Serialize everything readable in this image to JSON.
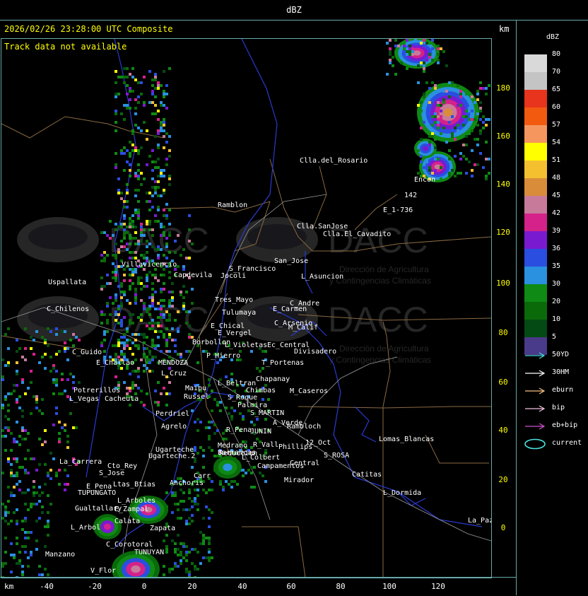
{
  "header": {
    "title": "dBZ"
  },
  "map": {
    "timestamp": "2026/02/26 23:28:00 UTC Composite",
    "track_message": "Track data not available",
    "km_label_top": "km",
    "km_label_bottom": "km",
    "watermark": {
      "name": "DACC",
      "line1": "Dirección de Agricultura",
      "line2": "y Contingencias Climáticas"
    },
    "y_ticks": [
      "180",
      "160",
      "140",
      "120",
      "100",
      "80",
      "60",
      "40",
      "20",
      "0"
    ],
    "x_ticks": [
      "-40",
      "-20",
      "0",
      "20",
      "40",
      "60",
      "80",
      "100",
      "120"
    ],
    "places": [
      "Clla.del_Rosario",
      "Encon",
      "142",
      "E_1-736",
      "Ramblon",
      "Clla.SanJose",
      "Clla.El_Cavadito",
      "San_Jose",
      "S_Francisco",
      "L_Asuncion",
      "Uspallata",
      "Villavicencio",
      "Capdevila",
      "Jocoli",
      "Tres_Mayo",
      "Tulumaya",
      "C_Andre",
      "E_Carmen",
      "C_Chilenos",
      "E_Chical",
      "E_Vergel",
      "C_Arsenio",
      "M_Calif",
      "Borbollon",
      "L_Violetas",
      "Ec_Central",
      "Divisadero",
      "C_Guido",
      "E_Challao",
      "MENDOZA",
      "P_Hierro",
      "T_Portenas",
      "L_Cruz",
      "L_Beltran",
      "Chapanay",
      "Potrerillos",
      "Cacheuta",
      "Maipu",
      "Chimbas",
      "M_Caseros",
      "L_Vegas",
      "Russel",
      "S_Roque",
      "Palmira",
      "Perdriel",
      "S_MARTIN",
      "A_Verde",
      "Agrelo",
      "R_Pena",
      "JUNIN",
      "Rambloch",
      "Lomas_Blancas",
      "Ugarteche",
      "Medrano",
      "R_Vall",
      "Phillips",
      "12_Oct",
      "S_ROSA",
      "La_Carrera",
      "Cto_Rey",
      "Reduccion",
      "L_Colbert",
      "Campamentos",
      "Central",
      "Catitas",
      "S_Jose",
      "E_Pena",
      "Anchoris",
      "Carr",
      "Mirador",
      "TUPUNGATO",
      "L_Dormida",
      "L_Arbol",
      "Gualtallary",
      "E_Zampal",
      "La_Paz",
      "L_Arboles",
      "Calata",
      "Zapata",
      "C_Corotoral",
      "Manzano",
      "TUNUYAN",
      "V_Flor",
      "Ltas_Btias",
      "Barrancas",
      "Ugarteche.2"
    ]
  },
  "legend": {
    "title": "dBZ",
    "scale": [
      {
        "label": "80",
        "color": "#d9d9d9"
      },
      {
        "label": "70",
        "color": "#c4c4c4"
      },
      {
        "label": "65",
        "color": "#e8341c"
      },
      {
        "label": "60",
        "color": "#f25a10"
      },
      {
        "label": "57",
        "color": "#f5965f"
      },
      {
        "label": "54",
        "color": "#ffff00"
      },
      {
        "label": "51",
        "color": "#f5c030"
      },
      {
        "label": "48",
        "color": "#d98c3a"
      },
      {
        "label": "45",
        "color": "#c87a9a"
      },
      {
        "label": "42",
        "color": "#d4228a"
      },
      {
        "label": "39",
        "color": "#7a1ad0"
      },
      {
        "label": "36",
        "color": "#2a4ee0"
      },
      {
        "label": "35",
        "color": "#2a90e0"
      },
      {
        "label": "30",
        "color": "#0f8a14"
      },
      {
        "label": "20",
        "color": "#0a6a0a"
      },
      {
        "label": "10",
        "color": "#044a14"
      },
      {
        "label": "5",
        "color": "#4a3a8a"
      }
    ],
    "tracks": [
      {
        "label": "50YD",
        "color": "#4dd"
      },
      {
        "label": "30HM",
        "color": "#fff"
      },
      {
        "label": "eburn",
        "color": "#f5c080"
      },
      {
        "label": "bip",
        "color": "#f0c0e0"
      },
      {
        "label": "eb+bip",
        "color": "#d050d0"
      }
    ],
    "current_label": "current",
    "current_color": "#4de0e0"
  }
}
